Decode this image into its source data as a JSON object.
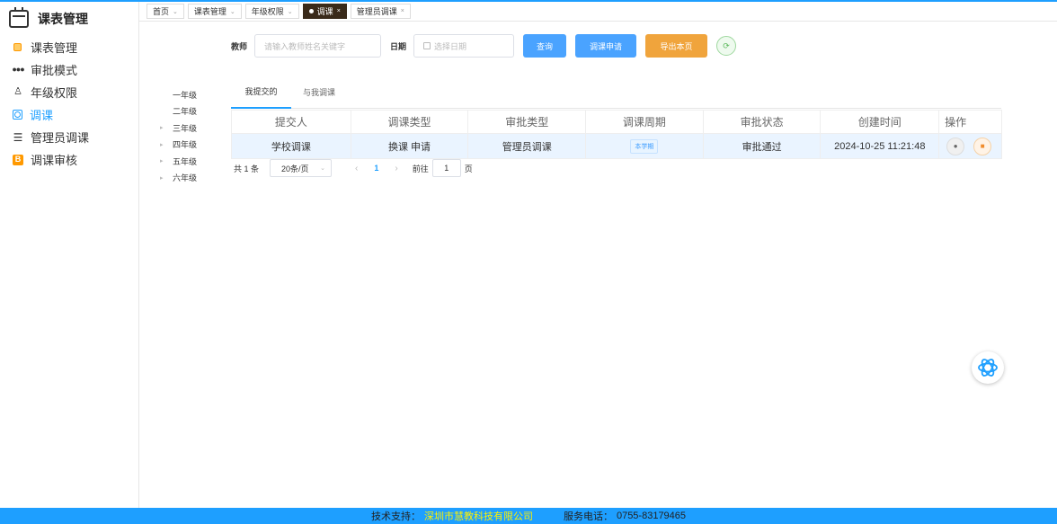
{
  "sidebar": {
    "title": "课表管理",
    "items": [
      {
        "label": "课表管理",
        "icon": "table-icon"
      },
      {
        "label": "审批模式",
        "icon": "grid-dots-icon"
      },
      {
        "label": "年级权限",
        "icon": "user-icon"
      },
      {
        "label": "调课",
        "icon": "adjust-icon"
      },
      {
        "label": "管理员调课",
        "icon": "admin-icon"
      },
      {
        "label": "调课审核",
        "icon": "review-icon"
      }
    ],
    "active": "调课"
  },
  "tabs": [
    {
      "label": "首页"
    },
    {
      "label": "课表管理"
    },
    {
      "label": "年级权限"
    },
    {
      "label": "调课",
      "active": true
    },
    {
      "label": "管理员调课"
    }
  ],
  "search": {
    "teacher_label": "教师",
    "teacher_placeholder": "请输入教师姓名关键字",
    "date_label": "日期",
    "date_placeholder": "选择日期",
    "query_label": "查询",
    "apply_label": "调课申请",
    "export_label": "导出本页"
  },
  "grades": [
    "一年级",
    "二年级",
    "三年级",
    "四年级",
    "五年级",
    "六年级"
  ],
  "subtabs": {
    "mine": "我提交的",
    "related": "与我调课"
  },
  "table": {
    "headers": [
      "提交人",
      "调课类型",
      "审批类型",
      "调课周期",
      "审批状态",
      "创建时间",
      "操作"
    ],
    "rows": [
      {
        "submitter": "学校调课",
        "type": "换课 申请",
        "approval_type": "管理员调课",
        "period": "本学期",
        "status": "审批通过",
        "created": "2024-10-25 11:21:48"
      }
    ]
  },
  "pagination": {
    "total": "共 1 条",
    "page_size": "20条/页",
    "current": "1",
    "goto_label": "前往",
    "goto_value": "1",
    "page_suffix": "页"
  },
  "footer": {
    "support_label": "技术支持：",
    "company": "深圳市慧教科技有限公司",
    "phone_label": "服务电话：",
    "phone": "0755-83179465"
  },
  "colors": {
    "accent": "#1e9fff",
    "export": "#f0a43c",
    "active_tab": "#3a2a1a"
  }
}
